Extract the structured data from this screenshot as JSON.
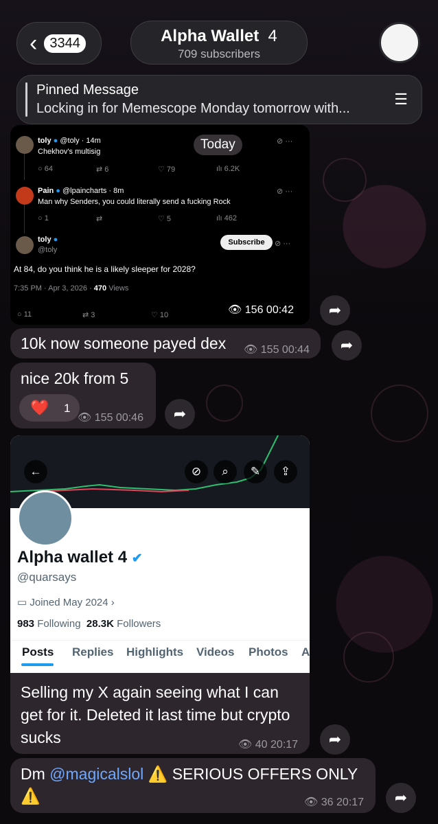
{
  "header": {
    "back_count": "3344",
    "channel_title": "Alpha Wallet",
    "channel_title_suffix": "4",
    "subscribers": "709 subscribers"
  },
  "pinned": {
    "label": "Pinned Message",
    "text": "Locking in for Memescope Monday tomorrow with..."
  },
  "date_badge": "Today",
  "tweet_screenshot": {
    "t1": {
      "name": "toly",
      "handle": "@toly · 14m",
      "text": "Chekhov's multisig",
      "replies": "64",
      "retweets": "6",
      "likes": "79",
      "views": "6.2K"
    },
    "t2": {
      "name": "Pain",
      "handle": "@lpaincharts · 8m",
      "text": "Man why Senders, you could literally send a fucking Rock",
      "replies": "1",
      "likes": "5",
      "views": "462"
    },
    "t3": {
      "name": "toly",
      "handle": "@toly",
      "subscribe": "Subscribe",
      "text": "At 84, do you think he is a likely sleeper for 2028?",
      "time": "7:35 PM · Apr 3, 2026 ·",
      "views_num": "470",
      "views_label": "Views",
      "replies": "11",
      "retweets": "3",
      "likes": "10"
    }
  },
  "messages": [
    {
      "views": "156",
      "time": "00:42"
    },
    {
      "text": "10k now someone payed dex",
      "views": "155",
      "time": "00:44"
    },
    {
      "text": "nice 20k from 5",
      "reaction_emoji": "❤️",
      "reaction_count": "1",
      "views": "155",
      "time": "00:46"
    },
    {
      "text": "Selling my X again seeing what I can get for it. Deleted it last time but crypto sucks",
      "views": "40",
      "time": "20:17"
    },
    {
      "text_prefix": "Dm",
      "mention": "@magicalslol",
      "text_suffix": "⚠️ SERIOUS OFFERS ONLY ⚠️",
      "views": "36",
      "time": "20:17"
    }
  ],
  "profile": {
    "display_name": "Alpha wallet 4",
    "handle": "@quarsays",
    "joined": "Joined May 2024",
    "following_count": "983",
    "following_label": "Following",
    "followers_count": "28.3K",
    "followers_label": "Followers",
    "tabs": [
      "Posts",
      "Replies",
      "Highlights",
      "Videos",
      "Photos",
      "A"
    ]
  },
  "colors": {
    "bubble": "#2d262d",
    "accent_link": "#6ea8ff",
    "x_blue": "#1d9bf0",
    "heart": "#e0245e"
  }
}
